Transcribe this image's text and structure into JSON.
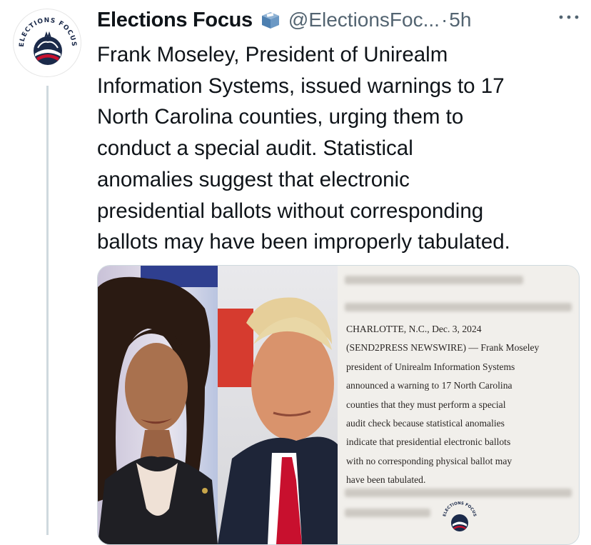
{
  "account": {
    "display_name": "Elections Focus",
    "handle": "@ElectionsFoc...",
    "separator": "·",
    "time": "5h",
    "avatar_ring_text": "ELECTIONS FOCUS",
    "badge_icon": "ballot-box-icon"
  },
  "tweet": {
    "lines": [
      "Frank Moseley, President of Unirealm",
      "Information Systems, issued warnings to 17",
      "North Carolina counties, urging them to",
      "conduct a special audit. Statistical",
      "anomalies suggest that electronic",
      "presidential ballots without corresponding",
      "ballots may have been improperly tabulated."
    ]
  },
  "news": {
    "lines": [
      "CHARLOTTE, N.C., Dec. 3, 2024",
      "(SEND2PRESS NEWSWIRE) — Frank Moseley",
      "president of Unirealm Information Systems",
      "announced a warning to 17 North Carolina",
      "counties that they must perform a special",
      "audit check because statistical anomalies",
      "indicate that presidential electronic ballots",
      "with no corresponding physical ballot may",
      "have been tabulated."
    ],
    "logo_text": "ELECTIONS FOCUS"
  },
  "colors": {
    "name": "#0f1419",
    "secondary": "#536471",
    "line": "#cfd9de",
    "accent_red": "#c8102e",
    "accent_navy": "#1b2a4a"
  }
}
